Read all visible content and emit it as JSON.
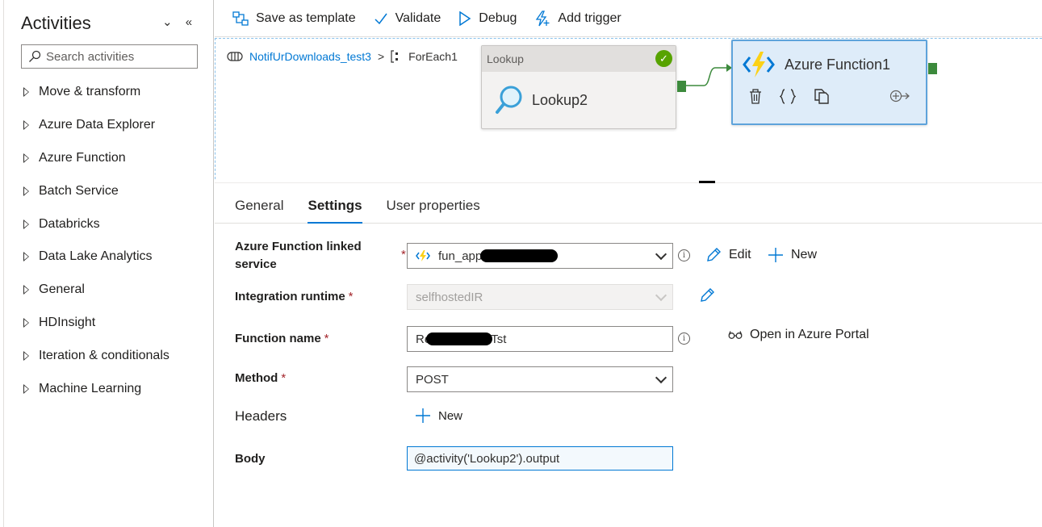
{
  "sidebar": {
    "title": "Activities",
    "collapse_icons": "⌄ «",
    "search_placeholder": "Search activities",
    "items": [
      {
        "label": "Move & transform"
      },
      {
        "label": "Azure Data Explorer"
      },
      {
        "label": "Azure Function"
      },
      {
        "label": "Batch Service"
      },
      {
        "label": "Databricks"
      },
      {
        "label": "Data Lake Analytics"
      },
      {
        "label": "General"
      },
      {
        "label": "HDInsight"
      },
      {
        "label": "Iteration & conditionals"
      },
      {
        "label": "Machine Learning"
      }
    ]
  },
  "toolbar": {
    "save_template": "Save as template",
    "validate": "Validate",
    "debug": "Debug",
    "add_trigger": "Add trigger"
  },
  "breadcrumb": {
    "pipeline": "NotifUrDownloads_test3",
    "separator": ">",
    "current": "ForEach1"
  },
  "canvas": {
    "lookup": {
      "header": "Lookup",
      "name": "Lookup2"
    },
    "function": {
      "name": "Azure Function1"
    }
  },
  "tabs": [
    {
      "label": "General"
    },
    {
      "label": "Settings"
    },
    {
      "label": "User properties"
    }
  ],
  "form": {
    "linked_service": {
      "label": "Azure Function linked service",
      "value": "fun_app",
      "edit": "Edit",
      "new": "New"
    },
    "integration_runtime": {
      "label": "Integration runtime",
      "value": "selfhostedIR"
    },
    "function_name": {
      "label": "Function name",
      "value_prefix": "Re",
      "value_suffix": "Tst",
      "portal": "Open in Azure Portal"
    },
    "method": {
      "label": "Method",
      "value": "POST"
    },
    "headers": {
      "label": "Headers",
      "new": "New"
    },
    "body": {
      "label": "Body",
      "value": "@activity('Lookup2').output"
    },
    "required_mark": "*"
  },
  "colors": {
    "accent": "#0078d4",
    "success": "#57a300",
    "port": "#3c8a3c",
    "function_bg": "#deecf9"
  }
}
